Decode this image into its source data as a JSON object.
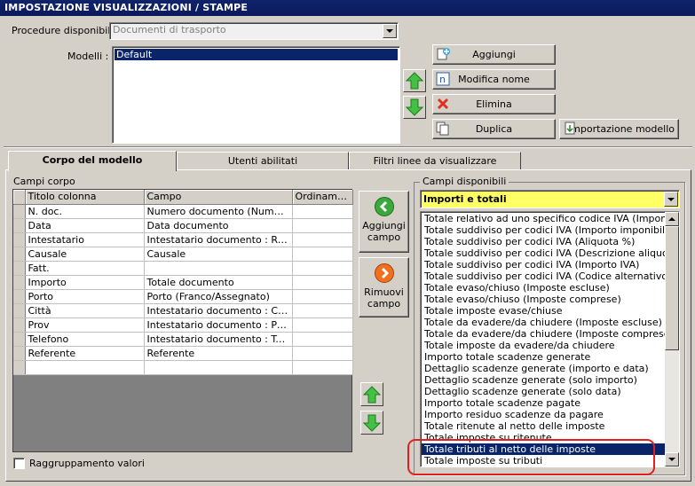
{
  "window": {
    "title": "IMPOSTAZIONE VISUALIZZAZIONI / STAMPE"
  },
  "top": {
    "procedure_label": "Procedure disponibili :",
    "procedure_value": "Documenti di trasporto",
    "modelli_label": "Modelli :",
    "modelli_items": [
      "Default"
    ]
  },
  "buttons": {
    "aggiungi": "Aggiungi",
    "modifica_nome": "Modifica nome",
    "elimina": "Elimina",
    "duplica": "Duplica",
    "importazione": "Importazione modello",
    "aggiungi_campo": "Aggiungi campo",
    "rimuovi_campo": "Rimuovi campo"
  },
  "tabs": [
    {
      "label": "Corpo del modello",
      "active": true
    },
    {
      "label": "Utenti abilitati",
      "active": false
    },
    {
      "label": "Filtri linee da visualizzare",
      "active": false
    }
  ],
  "campi_corpo": {
    "label": "Campi corpo",
    "columns": [
      "Titolo colonna",
      "Campo",
      "Ordiname..."
    ],
    "rows": [
      [
        "N. doc.",
        "Numero documento (Numero+...",
        ""
      ],
      [
        "Data",
        "Data documento",
        ""
      ],
      [
        "Intestatario",
        "Intestatario documento : Ragi...",
        ""
      ],
      [
        "Causale",
        "Causale",
        ""
      ],
      [
        "Fatt.",
        "",
        ""
      ],
      [
        "Importo",
        "Totale documento",
        ""
      ],
      [
        "Porto",
        "Porto (Franco/Assegnato)",
        ""
      ],
      [
        "Città",
        "Intestatario documento : Citta'",
        ""
      ],
      [
        "Prov",
        "Intestatario documento : Provi...",
        ""
      ],
      [
        "Telefono",
        "Intestatario documento : Telef...",
        ""
      ],
      [
        "Referente",
        "Referente",
        ""
      ],
      [
        "",
        "",
        ""
      ]
    ]
  },
  "raggruppamento_label": "Raggruppamento valori",
  "campi_disponibili": {
    "label": "Campi disponibili",
    "category": "Importi e totali",
    "items": [
      "Totale relativo ad uno specifico codice IVA (Imponibile+IVA)",
      "Totale suddiviso per codici IVA (Importo imponibile)",
      "Totale suddiviso per codici IVA (Aliquota %)",
      "Totale suddiviso per codici IVA (Descrizione aliquota)",
      "Totale suddiviso per codici IVA (Importo IVA)",
      "Totale suddiviso per codici IVA (Codice alternativo aliquota)",
      "Totale evaso/chiuso (Imposte escluse)",
      "Totale evaso/chiuso (Imposte comprese)",
      "Totale imposte evase/chiuse",
      "Totale da evadere/da chiudere (Imposte escluse)",
      "Totale da evadere/da chiudere (Imposte comprese)",
      "Totale imposte da evadere/da chiudere",
      "Importo totale scadenze generate",
      "Dettaglio scadenze generate (importo e data)",
      "Dettaglio scadenze generate (solo importo)",
      "Dettaglio scadenze generate (solo data)",
      "Importo totale scadenze pagate",
      "Importo residuo scadenze da pagare",
      "Totale ritenute al netto delle imposte",
      "Totale imposte su ritenute",
      "Totale tributi al netto delle imposte",
      "Totale imposte su tributi"
    ],
    "selected_index": 20
  },
  "colors": {
    "highlight": "#e02020",
    "selection": "#0a246a",
    "combo_yellow": "#ffff66"
  }
}
